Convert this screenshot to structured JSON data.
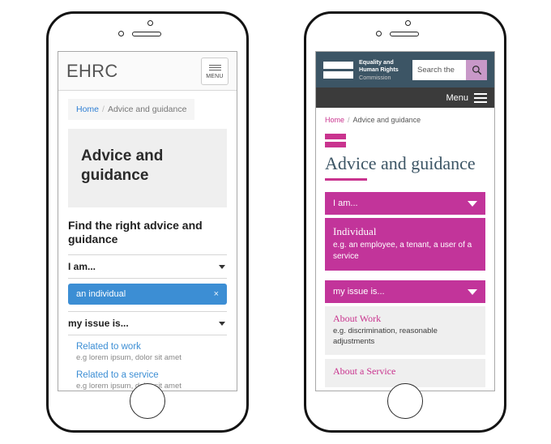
{
  "colors": {
    "brand_magenta": "#c2349a",
    "brand_pink": "#c9338e",
    "brand_slate": "#3c5565",
    "search_button": "#c898c8",
    "menu_bar": "#3b3b3b",
    "link_blue": "#3c8ed4"
  },
  "left_phone": {
    "header": {
      "logo": "EHRC",
      "menu_label": "MENU",
      "menu_icon": "hamburger-icon"
    },
    "breadcrumb": {
      "home": "Home",
      "separator": "/",
      "current": "Advice and guidance"
    },
    "hero": {
      "title": "Advice and guidance"
    },
    "subheading": "Find the right advice and guidance",
    "selects": [
      {
        "label": "I am...",
        "caret_icon": "caret-down-icon"
      },
      {
        "label": "my issue is...",
        "caret_icon": "caret-down-icon"
      }
    ],
    "selected_pill": {
      "label": "an individual",
      "remove_icon": "×"
    },
    "results": [
      {
        "title": "Related to work",
        "description": "e.g lorem ipsum, dolor sit amet"
      },
      {
        "title": "Related to a service",
        "description": "e.g lorem ipsum, dolor sit amet"
      }
    ]
  },
  "right_phone": {
    "brandbar": {
      "logo_icon": "equals-mark-icon",
      "logo_line1": "Equality and",
      "logo_line2": "Human Rights",
      "logo_line3": "Commission",
      "search_placeholder": "Search the",
      "search_icon": "search-icon"
    },
    "menubar": {
      "label": "Menu",
      "icon": "hamburger-icon"
    },
    "breadcrumb": {
      "home": "Home",
      "separator": "/",
      "current": "Advice and guidance"
    },
    "title": "Advice and guidance",
    "dropdowns": [
      {
        "label": "I am...",
        "caret_icon": "caret-down-icon"
      },
      {
        "label": "my issue is...",
        "caret_icon": "caret-down-icon"
      }
    ],
    "selected_option": {
      "title": "Individual",
      "description": "e.g. an employee, a tenant, a user of a service"
    },
    "items": [
      {
        "title": "About Work",
        "description": "e.g. discrimination, reasonable adjustments"
      },
      {
        "title": "About a Service",
        "description": ""
      }
    ]
  }
}
